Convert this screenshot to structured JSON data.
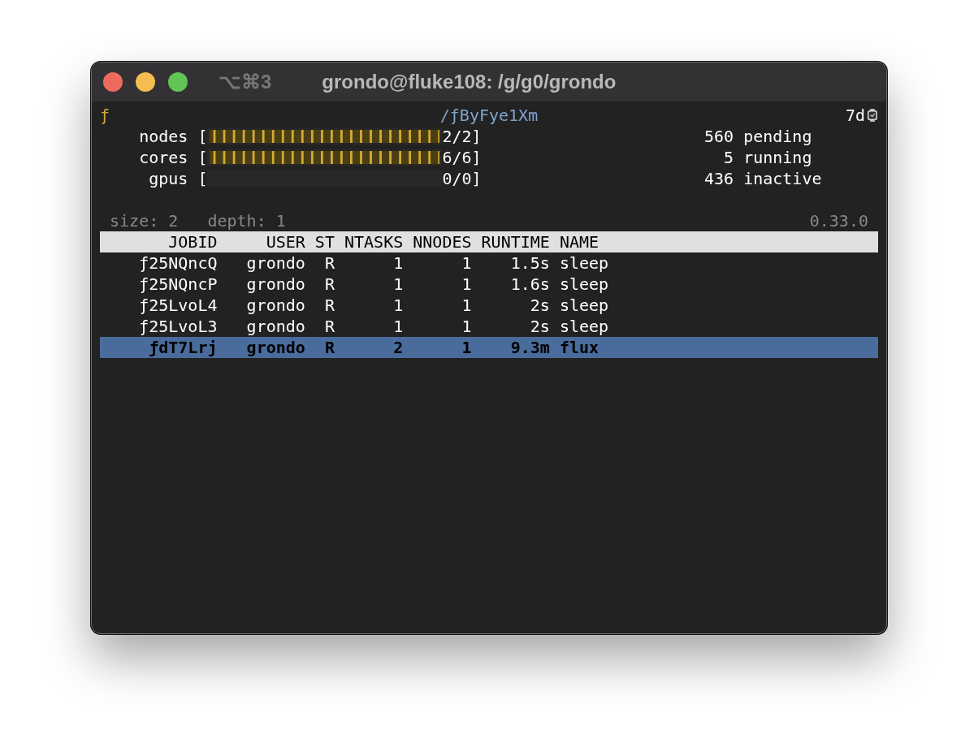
{
  "window": {
    "title": "grondo@fluke108: /g/g0/grondo",
    "shortcut": "⌥⌘3"
  },
  "header": {
    "logo": "ƒ",
    "path": "/ƒByFye1Xm",
    "uptime": "7d"
  },
  "resources": [
    {
      "name": "nodes",
      "open": "[",
      "level": 1,
      "reading": "2/2",
      "close": "]"
    },
    {
      "name": "cores",
      "open": "[",
      "level": 1,
      "reading": "6/6",
      "close": "]"
    },
    {
      "name": "gpus",
      "open": "[",
      "level": 0,
      "reading": "0/0",
      "close": "]"
    }
  ],
  "job_counts": [
    {
      "count": "560",
      "label": "pending"
    },
    {
      "count": "5",
      "label": "running"
    },
    {
      "count": "436",
      "label": "inactive"
    }
  ],
  "info": {
    "size": "size: 2",
    "depth": "depth: 1",
    "version": "0.33.0"
  },
  "table": {
    "columns": [
      "JOBID",
      "USER",
      "ST",
      "NTASKS",
      "NNODES",
      "RUNTIME",
      "NAME"
    ],
    "rows": [
      {
        "cells": [
          "ƒ25NQncQ",
          "grondo",
          "R",
          "1",
          "1",
          "1.5s",
          "sleep"
        ],
        "selected": false
      },
      {
        "cells": [
          "ƒ25NQncP",
          "grondo",
          "R",
          "1",
          "1",
          "1.6s",
          "sleep"
        ],
        "selected": false
      },
      {
        "cells": [
          "ƒ25LvoL4",
          "grondo",
          "R",
          "1",
          "1",
          "2s",
          "sleep"
        ],
        "selected": false
      },
      {
        "cells": [
          "ƒ25LvoL3",
          "grondo",
          "R",
          "1",
          "1",
          "2s",
          "sleep"
        ],
        "selected": false
      },
      {
        "cells": [
          "ƒdT7Lrj",
          "grondo",
          "R",
          "2",
          "1",
          "9.3m",
          "flux"
        ],
        "selected": true
      }
    ]
  }
}
